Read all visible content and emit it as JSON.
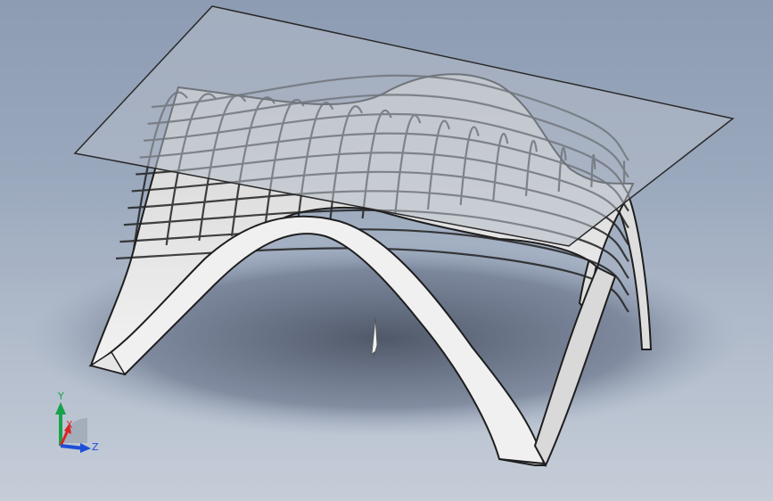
{
  "viewport": {
    "background_top": "#8d9cb3",
    "background_bottom": "#c5cdd8",
    "model": {
      "shell_color": "#e9e9e9",
      "shell_edge_color": "#1e1e1e",
      "glass_color": "#b4bcc8",
      "shadow_color": "#4a5566"
    }
  },
  "triad": {
    "y_label": "Y",
    "x_label": "X",
    "z_label": "Z",
    "y_color": "#16a34a",
    "x_color": "#dc2626",
    "z_color": "#1d4ed8"
  },
  "cursor_icon": "mouse-pointer-icon"
}
